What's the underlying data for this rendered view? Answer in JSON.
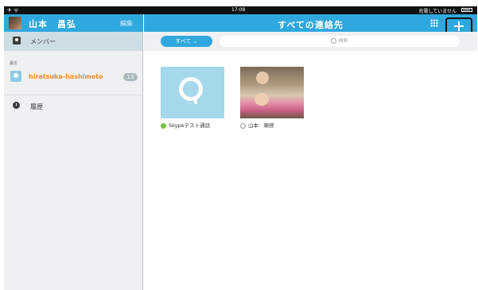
{
  "status_bar": {
    "left": "✈ ᯤ",
    "time": "17:08",
    "right": "充電していません"
  },
  "sidebar": {
    "profile_name": "山本　昌弘",
    "edit_label": "編集",
    "members_label": "メンバー",
    "recent_label": "最近",
    "recent_items": [
      {
        "name": "hiratsuka-hashimoto",
        "badge": "13"
      }
    ],
    "history_label": "履歴"
  },
  "main": {
    "title": "すべての連絡先",
    "filter_label": "すべて ⌄",
    "search_placeholder": "検索",
    "contacts": [
      {
        "name": "Skypeテスト通話",
        "status": "online"
      },
      {
        "name": "山本　順啓",
        "status": "offline"
      }
    ]
  },
  "colors": {
    "accent": "#2ea8df",
    "highlight": "#f08a24",
    "sidebar_bg": "#eef0f2"
  }
}
